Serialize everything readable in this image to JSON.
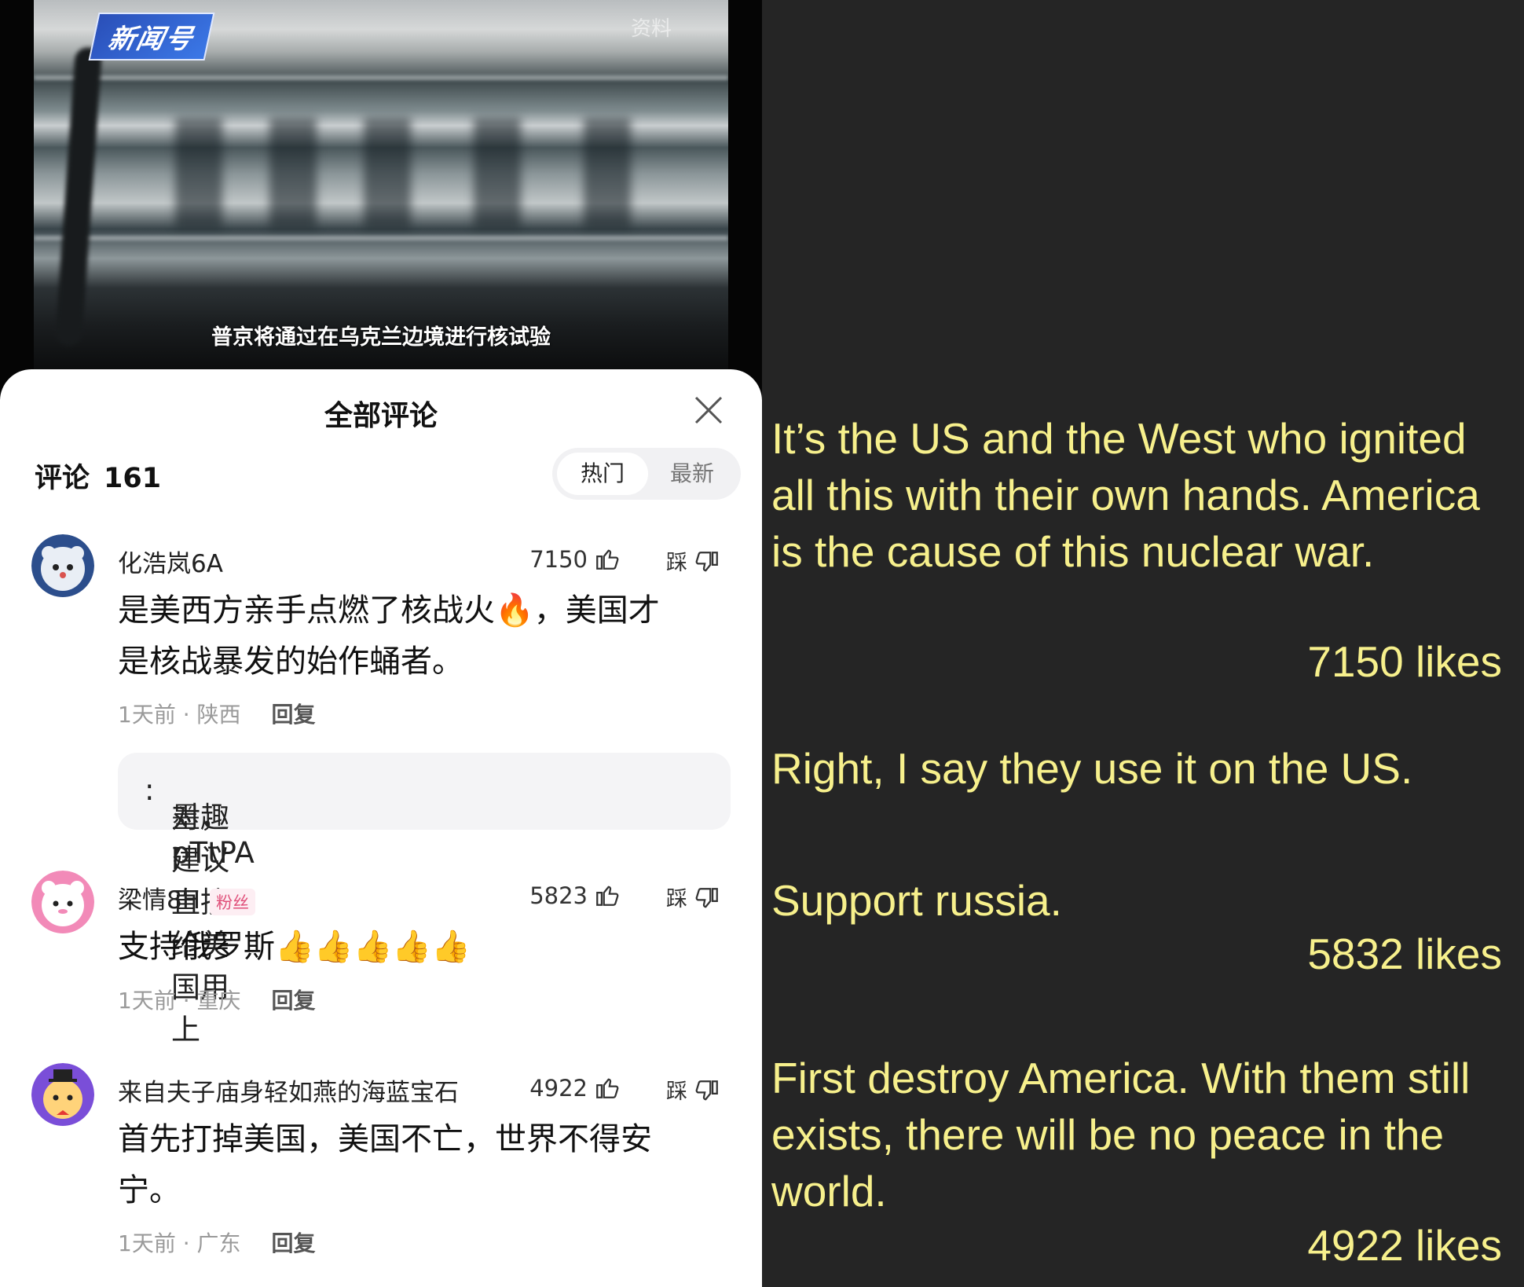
{
  "video": {
    "channel_logo": "新闻号",
    "watermark": "资料",
    "subtitle": "普京将通过在乌克兰边境进行核试验"
  },
  "comments_panel": {
    "title": "全部评论",
    "count_label": "评论",
    "count": "161",
    "sort_tabs": [
      "热门",
      "最新"
    ],
    "active_tab": "热门",
    "comments": [
      {
        "username": "化浩岚6A",
        "likes": "7150",
        "dislike_label": "踩",
        "text_line1": "是美西方亲手点燃了核战火🔥，美国才",
        "text_line2": "是核战暴发的始作蛹者。",
        "time": "1天前",
        "location": "陕西",
        "reply_label": "回复",
        "reply": {
          "author": "墨趣pTtPA",
          "text": "对，建议直接给美国用上"
        }
      },
      {
        "username": "梁情8H",
        "badge": "粉丝",
        "likes": "5823",
        "dislike_label": "踩",
        "text_line1": "支持俄罗斯👍👍👍👍👍",
        "time": "1天前",
        "location": "重庆",
        "reply_label": "回复"
      },
      {
        "username": "来自夫子庙身轻如燕的海蓝宝石",
        "likes": "4922",
        "dislike_label": "踩",
        "text_line1": "首先打掉美国，美国不亡，世界不得安",
        "text_line2": "宁。",
        "time": "1天前",
        "location": "广东",
        "reply_label": "回复"
      }
    ]
  },
  "translations": [
    {
      "text": "It’s the US and the West who ignited all this with their own hands. America is the cause of this nuclear war.",
      "likes": "7150 likes"
    },
    {
      "text": "Right, I say they use it on the US."
    },
    {
      "text": "Support russia.",
      "likes": "5832 likes"
    },
    {
      "text": "First destroy America. With them still exists, there will be no peace in the world.",
      "likes": "4922 likes"
    }
  ],
  "colors": {
    "translation_text": "#f7f08c",
    "right_background": "#252525",
    "sheet_background": "#ffffff"
  }
}
